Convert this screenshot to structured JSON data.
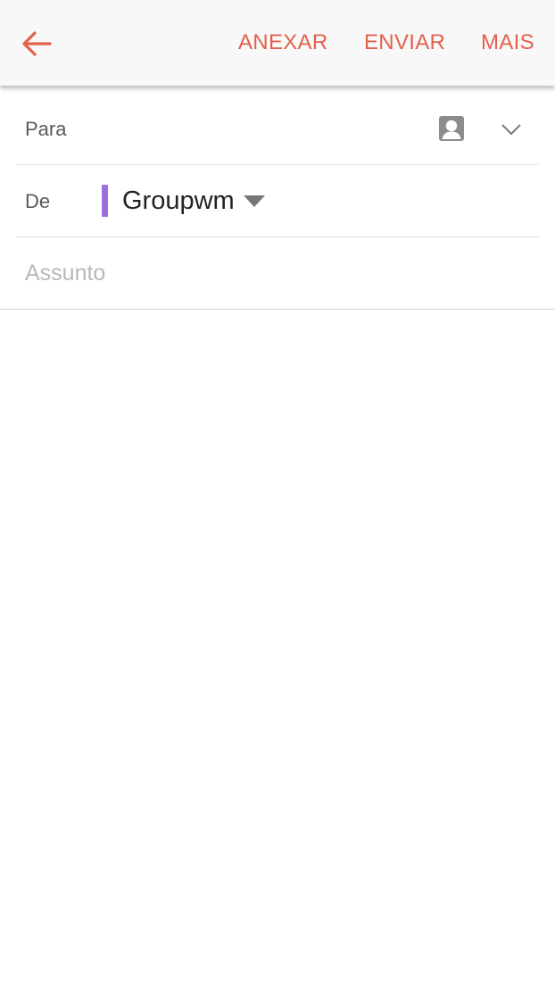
{
  "colors": {
    "accent": "#e2614b",
    "account_color": "#9c6fdc",
    "toolbar_bg": "#f8f8f8"
  },
  "toolbar": {
    "back_icon": "arrow-left-icon",
    "attach_label": "ANEXAR",
    "send_label": "ENVIAR",
    "more_label": "MAIS"
  },
  "compose": {
    "to_label": "Para",
    "to_value": "",
    "contact_icon": "contact-icon",
    "expand_icon": "chevron-down-icon",
    "from_label": "De",
    "from_account": "Groupwm",
    "subject_placeholder": "Assunto",
    "subject_value": "",
    "body_value": ""
  }
}
